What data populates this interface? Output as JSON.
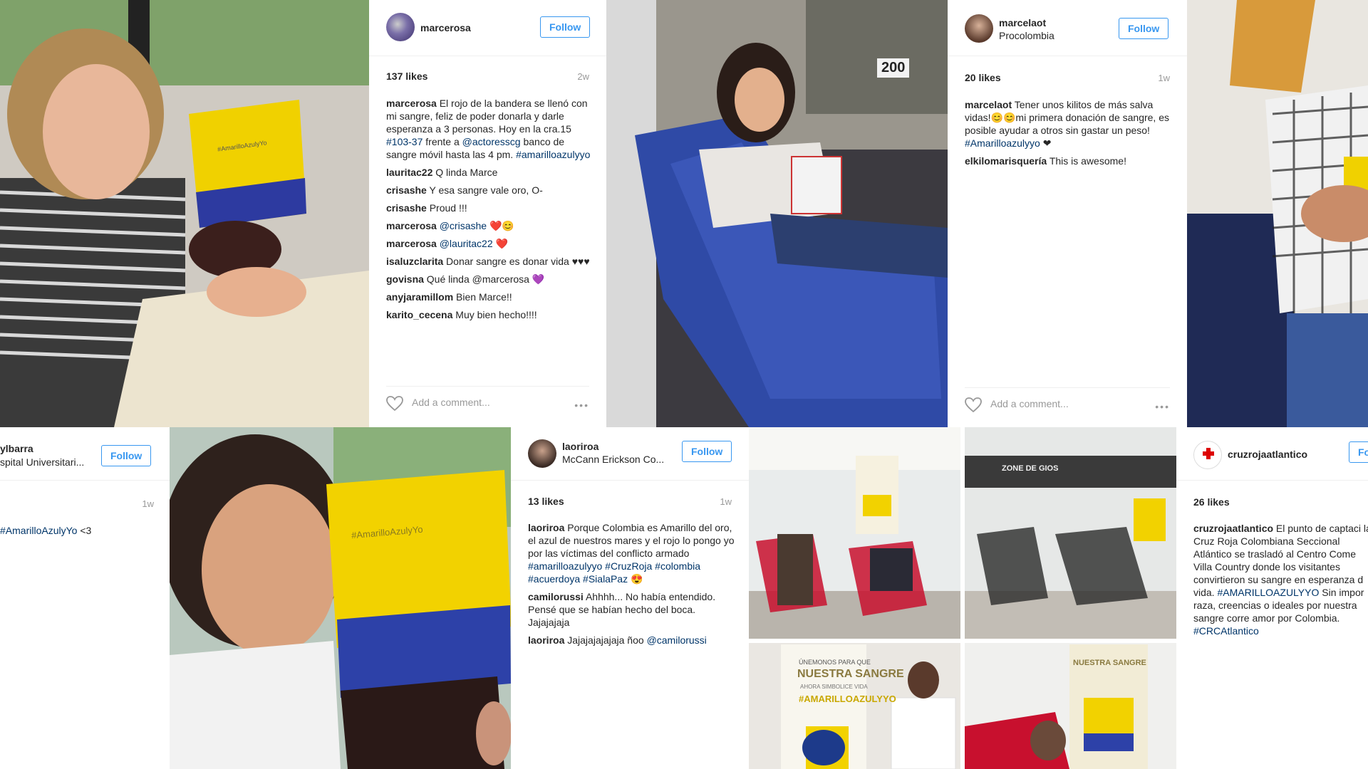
{
  "posts": [
    {
      "username": "marcerosa",
      "location": "",
      "follow_label": "Follow",
      "likes": "137 likes",
      "age": "2w",
      "caption": [
        {
          "user": "marcerosa",
          "text": "El rojo de la bandera se llenó con mi sangre, feliz de poder donarla y darle esperanza a 3 personas. Hoy en la cra.15 ",
          "tags": [
            "#103-37"
          ],
          "rest": " frente a ",
          "mention": "@actoresscg",
          "rest2": " banco de sangre móvil hasta las 4 pm. ",
          "tag2": "#amarilloazulyyo"
        }
      ],
      "comments": [
        {
          "user": "lauritac22",
          "text": "Q linda Marce"
        },
        {
          "user": "crisashe",
          "text": "Y esa sangre vale oro, O-"
        },
        {
          "user": "crisashe",
          "text": "Proud !!!"
        },
        {
          "user": "marcerosa",
          "text": "@crisashe ❤️😊"
        },
        {
          "user": "marcerosa",
          "text": "@lauritac22 ❤️"
        },
        {
          "user": "isaluzclarita",
          "text": "Donar sangre es donar vida ♥♥♥"
        },
        {
          "user": "govisna",
          "text": "Qué linda @marcerosa 💜"
        },
        {
          "user": "anyjaramillom",
          "text": "Bien Marce!!"
        },
        {
          "user": "karito_cecena",
          "text": "Muy bien hecho!!!!"
        }
      ],
      "add_comment": "Add a comment..."
    },
    {
      "username": "marcelaot",
      "location": "Procolombia",
      "follow_label": "Follow",
      "likes": "20 likes",
      "age": "1w",
      "caption": [
        {
          "user": "marcelaot",
          "text": "Tener unos kilitos de más salva vidas!😊😊mi primera donación de sangre, es posible ayudar a otros sin gastar un peso! ",
          "tag": "#Amarilloazulyyo",
          "after": " ❤"
        }
      ],
      "comments": [
        {
          "user": "elkilomarisquería",
          "text": "This is awesome!"
        }
      ],
      "add_comment": "Add a comment..."
    },
    {
      "username": "ylbarra",
      "location": "spital Universitari...",
      "follow_label": "Follow",
      "likes": "",
      "age": "1w",
      "caption_tag": "#AmarilloAzulyYo",
      "caption_after": " <3"
    },
    {
      "username": "laoriroa",
      "location": "McCann Erickson Co...",
      "follow_label": "Follow",
      "likes": "13 likes",
      "age": "1w",
      "caption": {
        "user": "laoriroa",
        "text": "Porque Colombia es Amarillo del oro, el azul de nuestros mares y el rojo lo pongo yo por las víctimas del conflicto armado ",
        "tags": "#amarilloazulyyo #CruzRoja #colombia #acuerdoya #SialaPaz",
        "after": " 😍"
      },
      "comments": [
        {
          "user": "camilorussi",
          "text": "Ahhhh... No había entendido. Pensé que se habían hecho del boca. Jajajajaja"
        },
        {
          "user": "laoriroa",
          "text": "Jajajajajajaja ñoo ",
          "mention": "@camilorussi"
        }
      ]
    },
    {
      "username": "cruzrojaatlantico",
      "location": "",
      "follow_label": "Fo",
      "likes": "26 likes",
      "caption": {
        "user": "cruzrojaatlantico",
        "text": "El punto de captaci la Cruz Roja Colombiana Seccional Atlántico se trasladó al Centro Come Villa Country donde los visitantes convirtieron su sangre en esperanza d vida. ",
        "tag": "#AMARILLOAZULYYO",
        "text2": " Sin impor raza, creencias o ideales por nuestra sangre corre amor por Colombia. ",
        "tag2": "#CRCAtlantico"
      }
    }
  ],
  "photo_text": {
    "bag_label_1": "#AmarilloAzulyYo",
    "bag_label_2": "#AmarilloAzulyYo",
    "bus_sign": "200",
    "banner_1_line1": "ÚNEMONOS PARA QUE",
    "banner_1_line2": "NUESTRA SANGRE",
    "banner_1_line3": "AHORA SIMBOLICE VIDA",
    "banner_1_line4": "#AMARILLOAZULYYO",
    "banner_2": "NUESTRA SANGRE",
    "store_sign": "ZONE DE GIOS"
  },
  "colors": {
    "follow_blue": "#3897f0",
    "tag_blue": "#003569",
    "flag_yellow": "#f2d200",
    "flag_blue": "#2d41a8",
    "flag_red": "#c8102e"
  }
}
